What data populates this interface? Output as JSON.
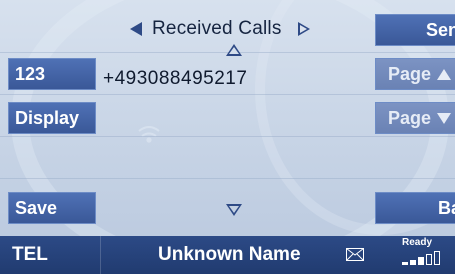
{
  "header": {
    "title": "Received Calls"
  },
  "call": {
    "number": "+493088495217"
  },
  "left_buttons": {
    "keypad": "123",
    "display": "Display",
    "save": "Save"
  },
  "right_buttons": {
    "send": "Send",
    "page_up": "Page",
    "page_down": "Page",
    "back": "Back"
  },
  "status_bar": {
    "mode": "TEL",
    "caller_name": "Unknown Name",
    "status": "Ready",
    "signal_level": "3 of 5 bars"
  },
  "colors": {
    "button": "#4062a5",
    "button_dim": "#7489bc",
    "status_bar": "#26427b",
    "background": "#c9d6e6"
  }
}
